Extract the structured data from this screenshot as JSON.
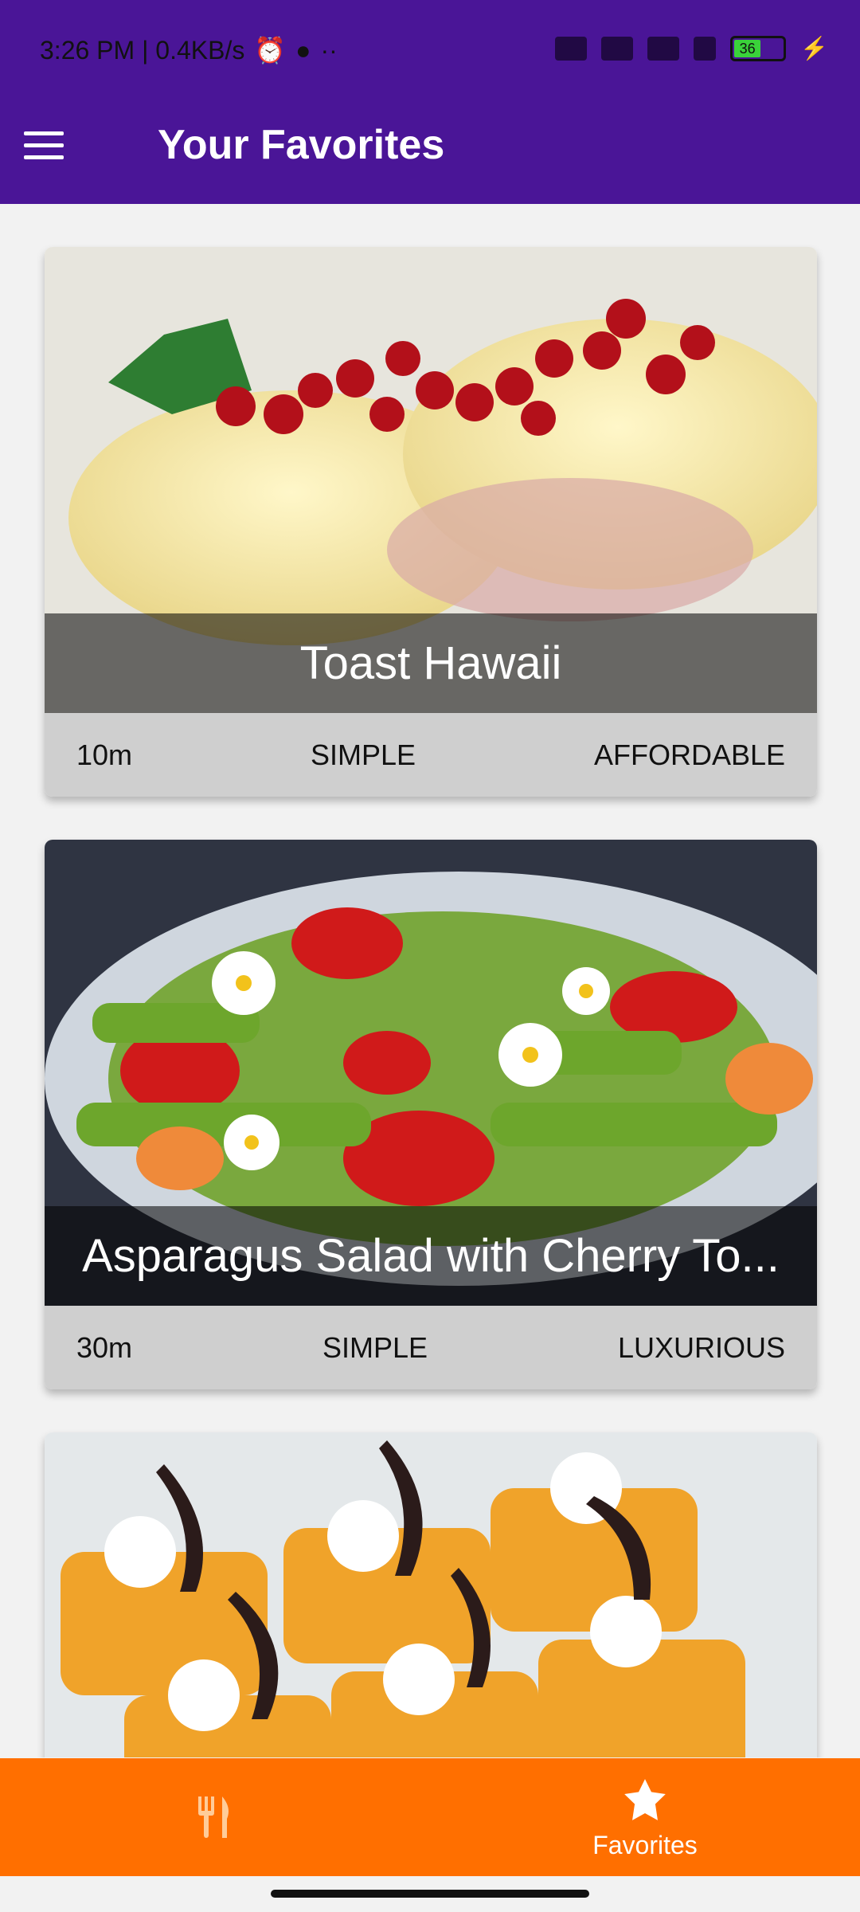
{
  "status": {
    "time_speed": "3:26 PM | 0.4KB/s",
    "battery": "36"
  },
  "appbar": {
    "title": "Your Favorites"
  },
  "meals": [
    {
      "title": "Toast Hawaii",
      "duration": "10m",
      "complexity": "SIMPLE",
      "affordability": "AFFORDABLE"
    },
    {
      "title": "Asparagus Salad with Cherry To...",
      "duration": "30m",
      "complexity": "SIMPLE",
      "affordability": "LUXURIOUS"
    },
    {
      "title": "",
      "duration": "",
      "complexity": "",
      "affordability": ""
    }
  ],
  "bottom_nav": {
    "left_icon": "utensils-icon",
    "right_icon": "star-icon",
    "right_label": "Favorites"
  },
  "colors": {
    "primary": "#4a1597",
    "accent": "#ff6f00"
  }
}
